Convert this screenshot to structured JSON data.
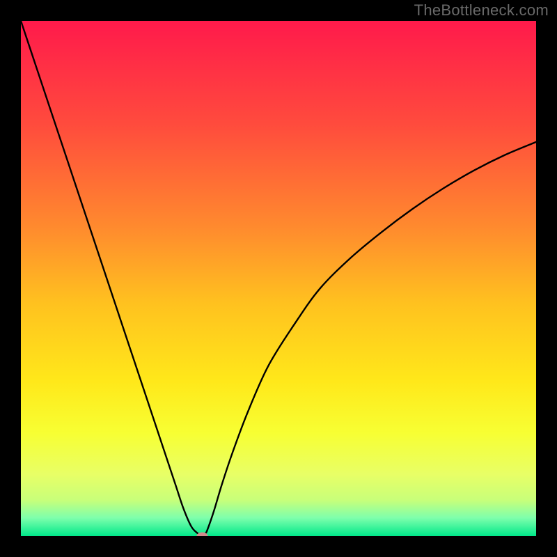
{
  "watermark": "TheBottleneck.com",
  "chart_data": {
    "type": "line",
    "title": "",
    "xlabel": "",
    "ylabel": "",
    "xlim": [
      0,
      100
    ],
    "ylim": [
      0,
      100
    ],
    "grid": false,
    "legend": false,
    "background_gradient": {
      "direction": "vertical",
      "stops": [
        {
          "offset": 0.0,
          "color": "#ff1a4b"
        },
        {
          "offset": 0.2,
          "color": "#ff4b3d"
        },
        {
          "offset": 0.4,
          "color": "#ff8a2e"
        },
        {
          "offset": 0.55,
          "color": "#ffc21f"
        },
        {
          "offset": 0.7,
          "color": "#ffe81a"
        },
        {
          "offset": 0.8,
          "color": "#f7ff33"
        },
        {
          "offset": 0.88,
          "color": "#e8ff66"
        },
        {
          "offset": 0.93,
          "color": "#c8ff7a"
        },
        {
          "offset": 0.965,
          "color": "#7dffac"
        },
        {
          "offset": 1.0,
          "color": "#00e88a"
        }
      ]
    },
    "series": [
      {
        "name": "bottleneck-curve",
        "color": "#000000",
        "x": [
          0.0,
          3,
          6,
          9,
          12,
          15,
          18,
          21,
          24,
          27,
          30,
          31.5,
          33,
          34,
          35,
          35.8,
          36.3,
          37.5,
          39,
          41,
          44,
          48,
          53,
          58,
          64,
          70,
          76,
          82,
          88,
          94,
          100
        ],
        "y": [
          100,
          91,
          82,
          73,
          64,
          55,
          46,
          37,
          28,
          19,
          10,
          5.5,
          2.0,
          0.8,
          0.2,
          0.5,
          1.5,
          5,
          10,
          16,
          24,
          33,
          41,
          48,
          54,
          59,
          63.5,
          67.5,
          71,
          74,
          76.5
        ]
      }
    ],
    "marker": {
      "name": "optimal-point",
      "x": 35.2,
      "y": 0.0,
      "rx": 1.1,
      "ry": 0.75,
      "color": "#d18a8c"
    }
  }
}
